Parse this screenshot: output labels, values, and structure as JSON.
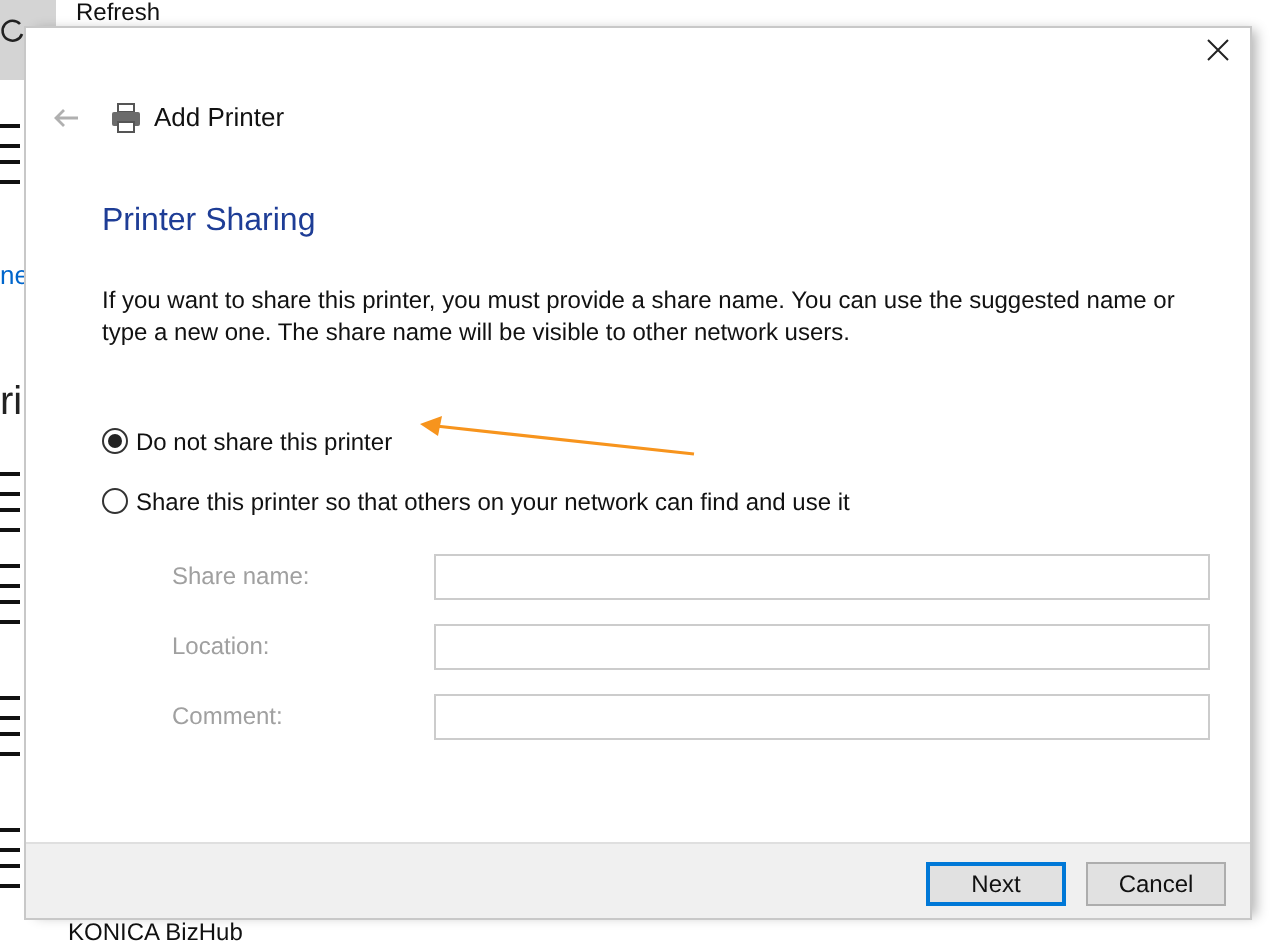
{
  "background_window": {
    "toolbar_item": "Refresh",
    "link": "ne",
    "heading": "ri",
    "list_item": "KONICA BizHub"
  },
  "dialog": {
    "title": "Add Printer",
    "heading": "Printer Sharing",
    "description": "If you want to share this printer, you must provide a share name. You can use the suggested name or type a new one. The share name will be visible to other network users.",
    "options": [
      {
        "label": "Do not share this printer",
        "selected": true
      },
      {
        "label": "Share this printer so that others on your network can find and use it",
        "selected": false
      }
    ],
    "fields": [
      {
        "label": "Share name:",
        "disabled": true
      },
      {
        "label": "Location:",
        "disabled": true
      },
      {
        "label": "Comment:",
        "disabled": true
      }
    ],
    "buttons": [
      {
        "label": "Next",
        "default": true
      },
      {
        "label": "Cancel",
        "default": false
      }
    ]
  }
}
